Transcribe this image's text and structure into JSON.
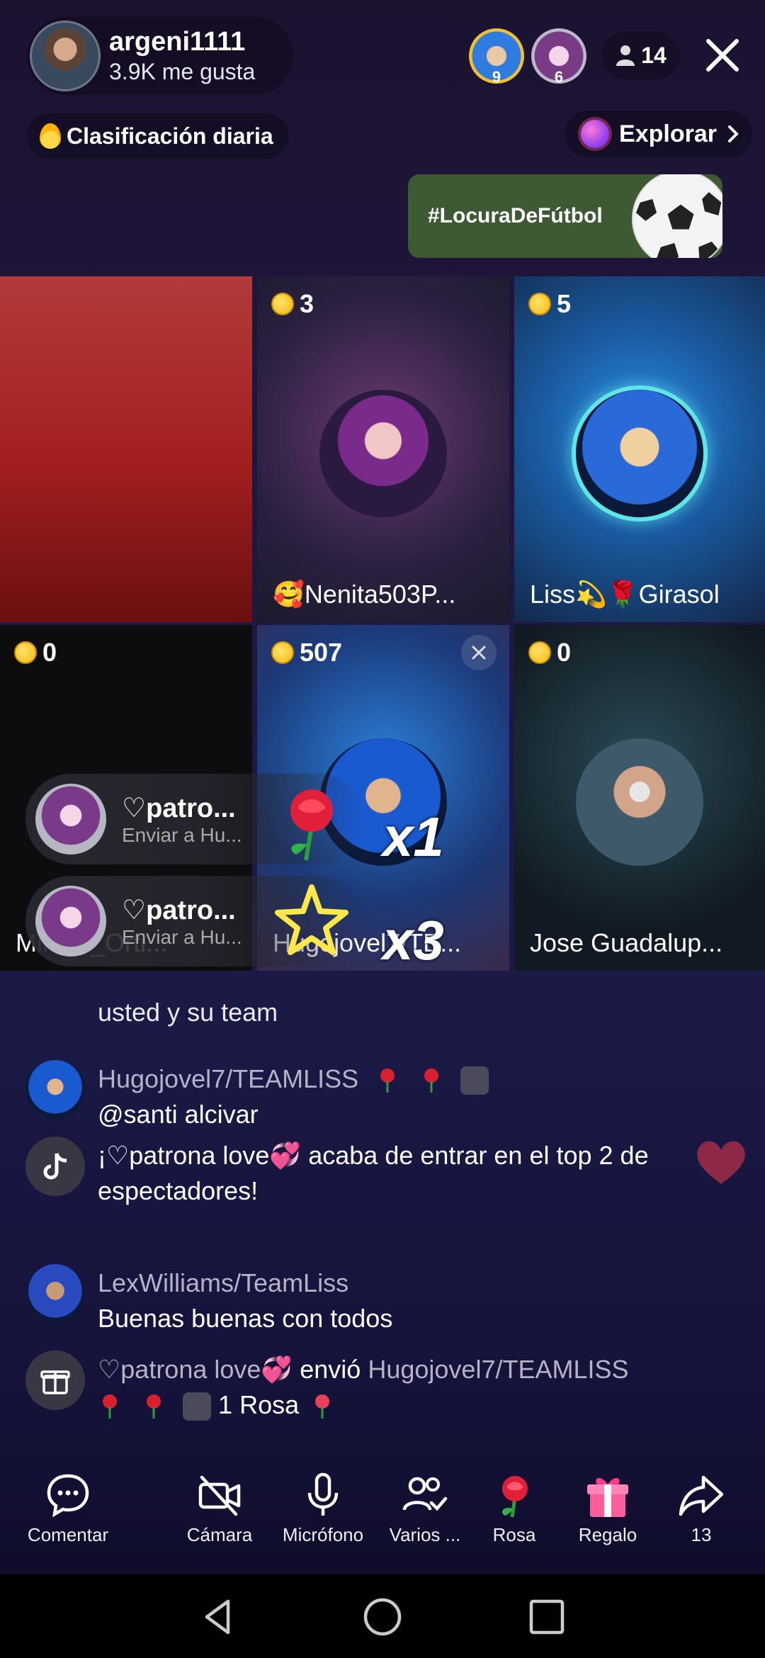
{
  "host": {
    "name": "argeni1111",
    "likes": "3.9K me gusta"
  },
  "top_viewers": [
    {
      "rank": "9"
    },
    {
      "rank": "6"
    }
  ],
  "viewer_count": "14",
  "ranking_label": "Clasificación diaria",
  "explore_label": "Explorar",
  "hashtag": "#LocuraDeFútbol",
  "tiles": [
    {
      "coins": "",
      "name": ""
    },
    {
      "coins": "3",
      "name": "🥰Nenita503P..."
    },
    {
      "coins": "5",
      "name": "Liss💫🌹Girasol"
    },
    {
      "coins": "0",
      "name": "Milena_Orti..."
    },
    {
      "coins": "507",
      "name": "Hugojovel7/TE..."
    },
    {
      "coins": "0",
      "name": "Jose Guadalup..."
    }
  ],
  "gift_notifications": [
    {
      "name": "♡patro...",
      "sub": "Enviar a Hu...",
      "multiplier": "x1",
      "gift": "rose"
    },
    {
      "name": "♡patro...",
      "sub": "Enviar a Hu...",
      "multiplier": "x3",
      "gift": "star"
    }
  ],
  "chat": {
    "clipped_text": "usted y su team",
    "messages": [
      {
        "user": "Hugojovel7/TEAMLISS",
        "text": "@santi alcivar"
      },
      {
        "system": "¡♡patrona love💞 acaba de entrar en el top 2 de espectadores!"
      },
      {
        "user": "LexWilliams/TeamLiss",
        "text": "Buenas buenas con todos"
      },
      {
        "gift_from": "♡patrona love💞",
        "gift_verb": "envió",
        "gift_to": "Hugojovel7/TEAMLISS",
        "gift_item": "1 Rosa"
      }
    ]
  },
  "bottom_bar": [
    {
      "label": "Comentar",
      "icon": "comment-icon"
    },
    {
      "label": "Cámara",
      "icon": "camera-off-icon"
    },
    {
      "label": "Micrófono",
      "icon": "microphone-icon"
    },
    {
      "label": "Varios ...",
      "icon": "multi-guest-icon"
    },
    {
      "label": "Rosa",
      "icon": "rose-icon"
    },
    {
      "label": "Regalo",
      "icon": "gift-icon"
    },
    {
      "label": "13",
      "icon": "share-icon"
    }
  ],
  "colors": {
    "accent_gold": "#f2b70f",
    "background": "#1b1a46"
  }
}
